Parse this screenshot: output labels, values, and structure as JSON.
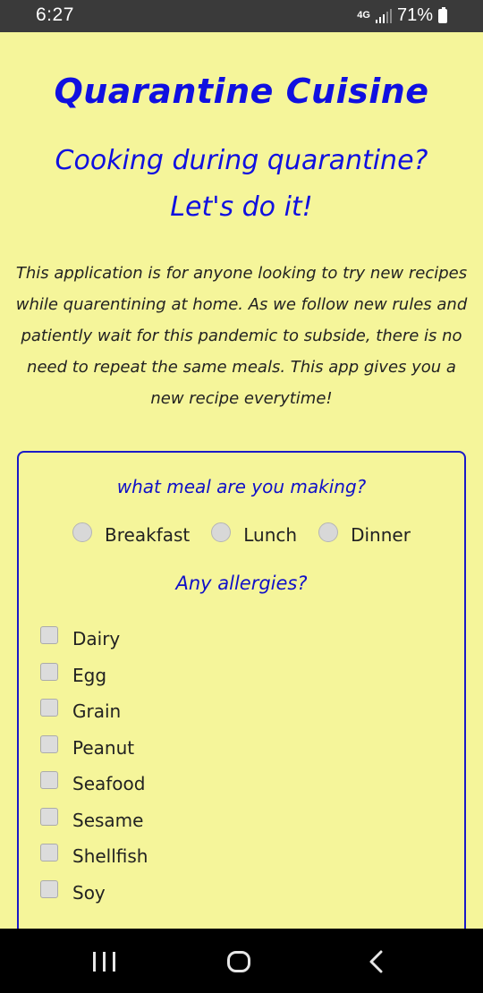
{
  "status_bar": {
    "time": "6:27",
    "network": "4G",
    "battery": "71%"
  },
  "header": {
    "app_title": "Quarantine Cuisine",
    "subtitle_line1": "Cooking during quarantine?",
    "subtitle_line2": "Let's do it!"
  },
  "description": "This application is for anyone looking to try new recipes while quarentining at home. As we follow new rules and patiently wait for this pandemic to subside, there is no need to repeat the same meals. This app gives you a new recipe everytime!",
  "form": {
    "meal_question": "what meal are you making?",
    "meal_options": [
      "Breakfast",
      "Lunch",
      "Dinner"
    ],
    "allergy_question": "Any allergies?",
    "allergies": [
      "Dairy",
      "Egg",
      "Grain",
      "Peanut",
      "Seafood",
      "Sesame",
      "Shellfish",
      "Soy"
    ]
  },
  "colors": {
    "background": "#f5f59a",
    "accent": "#1010e0",
    "text": "#222222"
  },
  "icons": {
    "nav_recent": "recent-apps-icon",
    "nav_home": "home-icon",
    "nav_back": "back-icon"
  }
}
